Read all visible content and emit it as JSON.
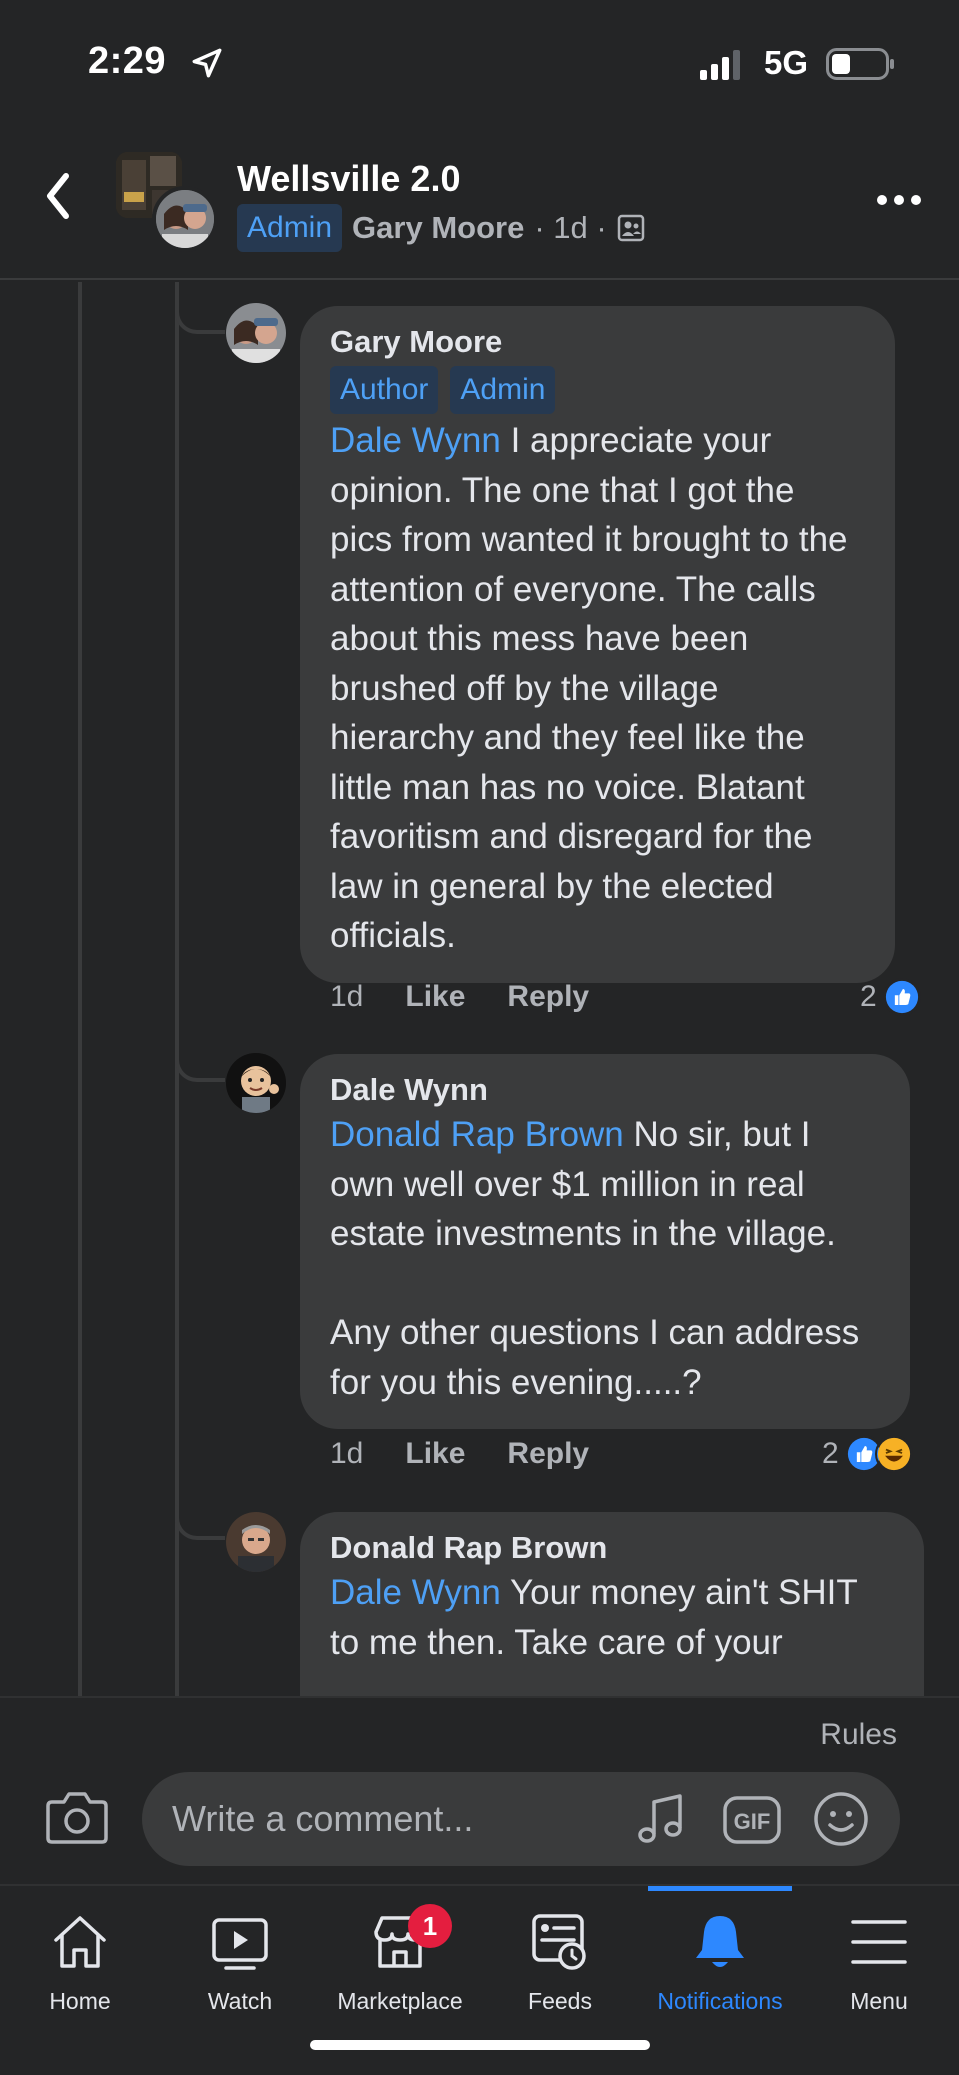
{
  "status_bar": {
    "time": "2:29",
    "network": "5G",
    "icons": [
      "location-arrow-icon",
      "signal-bars-icon",
      "battery-icon"
    ]
  },
  "header": {
    "group_name": "Wellsville 2.0",
    "badge": "Admin",
    "author": "Gary Moore",
    "meta": "· 1d ·",
    "icons": [
      "back-chevron-icon",
      "members-only-icon",
      "more-options-icon"
    ]
  },
  "comments": [
    {
      "author": "Gary Moore",
      "badges": [
        "Author",
        "Admin"
      ],
      "mention": "Dale Wynn",
      "text": " I appreciate your opinion. The one that I got the pics from wanted it brought to the attention of everyone. The calls about this mess have been brushed off by the village hierarchy and they feel like the little man has no voice. Blatant favoritism and disregard for the law in general by the elected officials.",
      "time": "1d",
      "like": "Like",
      "reply": "Reply",
      "reaction_count": "2",
      "reactions": [
        "like"
      ]
    },
    {
      "author": "Dale Wynn",
      "badges": [],
      "mention": "Donald Rap Brown",
      "text": " No sir, but I own well over $1 million in real estate investments in the village.\n\nAny other questions I can address for you this evening.....?",
      "time": "1d",
      "like": "Like",
      "reply": "Reply",
      "reaction_count": "2",
      "reactions": [
        "like",
        "haha"
      ]
    },
    {
      "author": "Donald Rap Brown",
      "badges": [],
      "mention": "Dale Wynn",
      "text": " Your money ain't SHIT to me then. Take care of your"
    }
  ],
  "composer": {
    "rules": "Rules",
    "placeholder": "Write a comment...",
    "gif": "GIF",
    "icons": [
      "camera-icon",
      "music-note-icon",
      "gif-icon",
      "emoji-icon"
    ]
  },
  "nav": {
    "items": [
      {
        "label": "Home",
        "icon": "home-icon"
      },
      {
        "label": "Watch",
        "icon": "watch-icon"
      },
      {
        "label": "Marketplace",
        "icon": "marketplace-icon",
        "badge": "1"
      },
      {
        "label": "Feeds",
        "icon": "feeds-icon"
      },
      {
        "label": "Notifications",
        "icon": "bell-icon",
        "active": true
      },
      {
        "label": "Menu",
        "icon": "hamburger-icon"
      }
    ]
  },
  "colors": {
    "background": "#242526",
    "bubble": "#3a3b3c",
    "accent": "#2d88ff",
    "mention": "#4ea0f5",
    "badge_bg": "#263951",
    "notification_red": "#e41e3f"
  }
}
